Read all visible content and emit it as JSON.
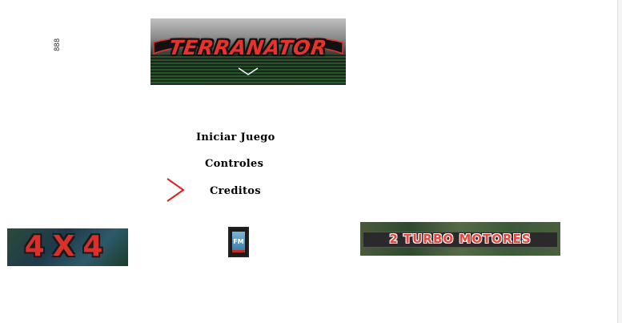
{
  "counter": {
    "value": "888"
  },
  "title_banner": {
    "text": "TERRANATOR"
  },
  "menu": {
    "items": [
      {
        "label": "Iniciar Juego"
      },
      {
        "label": "Controles"
      },
      {
        "label": "Creditos"
      }
    ],
    "selected_index": 2
  },
  "logos": {
    "four_by_four": "4X4",
    "fm": "FM",
    "turbo": "2 TURBO MOTORES"
  },
  "colors": {
    "cursor": "#e02020",
    "title_red": "#e8322e",
    "menu_text": "#000000",
    "background": "#ffffff"
  },
  "icons": {
    "cursor": "chevron-right-icon"
  }
}
